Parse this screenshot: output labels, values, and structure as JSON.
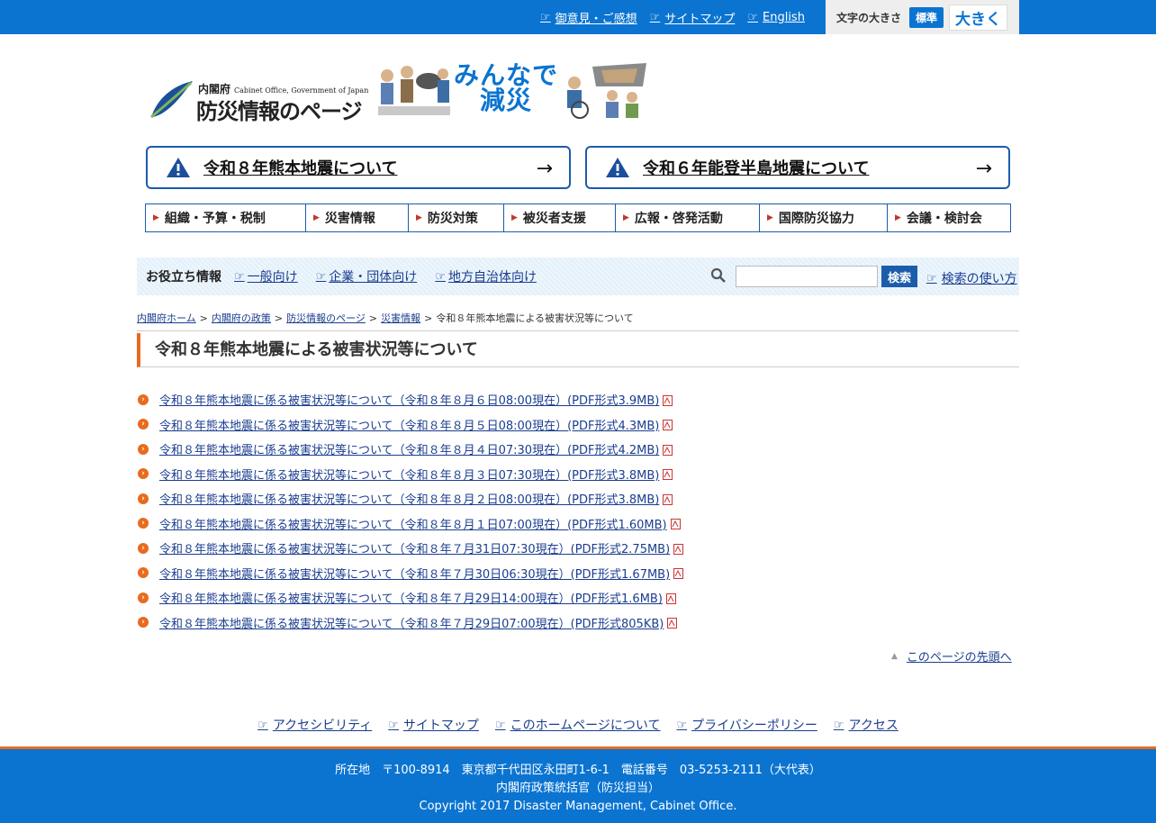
{
  "topbar": {
    "links": [
      "御意見・ご感想",
      "サイトマップ",
      "English"
    ],
    "fontsize_label": "文字の大きさ",
    "fontsize_standard": "標準",
    "fontsize_large": "大きく"
  },
  "logo": {
    "org_ja": "内閣府",
    "org_en": "Cabinet Office, Government of Japan",
    "site_title": "防災情報のページ",
    "slogan_line1": "みんなで",
    "slogan_line2": "減災"
  },
  "alerts": [
    {
      "label": "令和８年熊本地震について",
      "icon": "warning-icon",
      "arrow": "→"
    },
    {
      "label": "令和６年能登半島地震について",
      "icon": "warning-icon",
      "arrow": "→"
    }
  ],
  "gnav": [
    "組織・予算・税制",
    "災害情報",
    "防災対策",
    "被災者支援",
    "広報・啓発活動",
    "国際防災協力",
    "会議・検討会"
  ],
  "useful": {
    "label": "お役立ち情報",
    "links": [
      "一般向け",
      "企業・団体向け",
      "地方自治体向け"
    ],
    "search_placeholder": "",
    "search_button": "検索",
    "search_help": "検索の使い方"
  },
  "breadcrumb": {
    "items": [
      "内閣府ホーム",
      "内閣府の政策",
      "防災情報のページ",
      "災害情報"
    ],
    "separator": ">",
    "current": "令和８年熊本地震による被害状況等について"
  },
  "page_title": "令和８年熊本地震による被害状況等について",
  "documents": [
    "令和８年熊本地震に係る被害状況等について（令和８年８月６日08:00現在）(PDF形式3.9MB)",
    "令和８年熊本地震に係る被害状況等について（令和８年８月５日08:00現在）(PDF形式4.3MB)",
    "令和８年熊本地震に係る被害状況等について（令和８年８月４日07:30現在）(PDF形式4.2MB)",
    "令和８年熊本地震に係る被害状況等について（令和８年８月３日07:30現在）(PDF形式3.8MB)",
    "令和８年熊本地震に係る被害状況等について（令和８年８月２日08:00現在）(PDF形式3.8MB)",
    "令和８年熊本地震に係る被害状況等について（令和８年８月１日07:00現在）(PDF形式1.60MB)",
    "令和８年熊本地震に係る被害状況等について（令和８年７月31日07:30現在）(PDF形式2.75MB)",
    "令和８年熊本地震に係る被害状況等について（令和８年７月30日06:30現在）(PDF形式1.67MB)",
    "令和８年熊本地震に係る被害状況等について（令和８年７月29日14:00現在）(PDF形式1.6MB)",
    "令和８年熊本地震に係る被害状況等について（令和８年７月29日07:00現在）(PDF形式805KB)"
  ],
  "totop": "このページの先頭へ",
  "footer_links": [
    "アクセシビリティ",
    "サイトマップ",
    "このホームページについて",
    "プライバシーポリシー",
    "アクセス"
  ],
  "footer": {
    "address": "所在地　〒100-8914　東京都千代田区永田町1-6-1　電話番号　03-5253-2111（大代表）",
    "dept": "内閣府政策統括官（防災担当）",
    "copyright": "Copyright 2017 Disaster Management, Cabinet Office."
  },
  "colors": {
    "primary": "#0b74d1",
    "accent": "#e86b1f",
    "link": "#1a3d8f",
    "nav_border": "#1b5dab"
  }
}
